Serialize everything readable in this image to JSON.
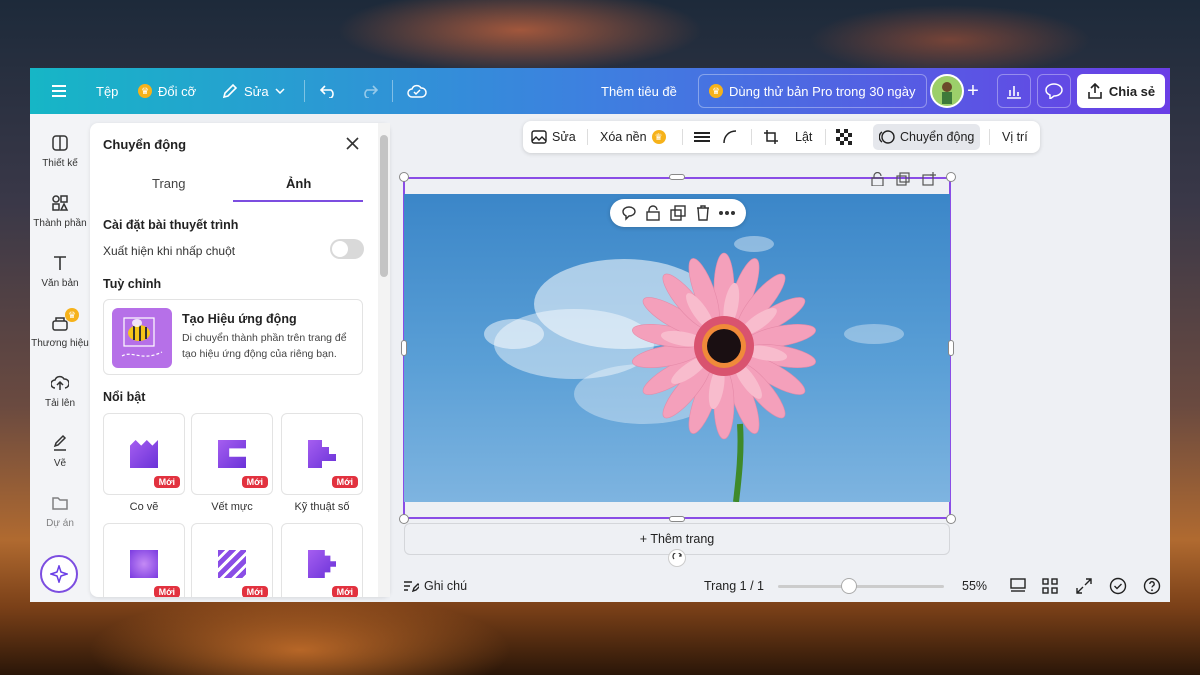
{
  "topbar": {
    "file": "Tệp",
    "resize": "Đổi cỡ",
    "edit": "Sửa",
    "title": "Thêm tiêu đề",
    "pro_trial": "Dùng thử bản Pro trong 30 ngày",
    "share": "Chia sẻ"
  },
  "rail": {
    "items": [
      {
        "label": "Thiết kế",
        "icon": "design-icon"
      },
      {
        "label": "Thành phần",
        "icon": "elements-icon"
      },
      {
        "label": "Văn bản",
        "icon": "text-icon"
      },
      {
        "label": "Thương hiệu",
        "icon": "brand-icon"
      },
      {
        "label": "Tải lên",
        "icon": "upload-icon"
      },
      {
        "label": "Vẽ",
        "icon": "draw-icon"
      },
      {
        "label": "Dự án",
        "icon": "folder-icon"
      }
    ]
  },
  "panel": {
    "title": "Chuyển động",
    "tabs": [
      "Trang",
      "Ảnh"
    ],
    "active_tab": "Ảnh",
    "presentation_heading": "Cài đặt bài thuyết trình",
    "click_appear": "Xuất hiện khi nhấp chuột",
    "click_appear_on": false,
    "custom_heading": "Tuỳ chỉnh",
    "create_title": "Tạo Hiệu ứng động",
    "create_desc": "Di chuyển thành phần trên trang để tạo hiệu ứng động của riêng bạn.",
    "featured_heading": "Nổi bật",
    "new_badge": "Mới",
    "tiles": [
      {
        "label": "Co vẽ"
      },
      {
        "label": "Vết mực"
      },
      {
        "label": "Kỹ thuật số"
      },
      {
        "label": ""
      },
      {
        "label": ""
      },
      {
        "label": ""
      }
    ]
  },
  "context_toolbar": {
    "edit": "Sửa",
    "remove_bg": "Xóa nền",
    "flip": "Lật",
    "animate": "Chuyển động",
    "position": "Vị trí"
  },
  "canvas": {
    "add_page": "+ Thêm trang"
  },
  "bottom": {
    "notes": "Ghi chú",
    "page": "Trang 1 / 1",
    "zoom": "55%",
    "zoom_level": 0.43
  }
}
